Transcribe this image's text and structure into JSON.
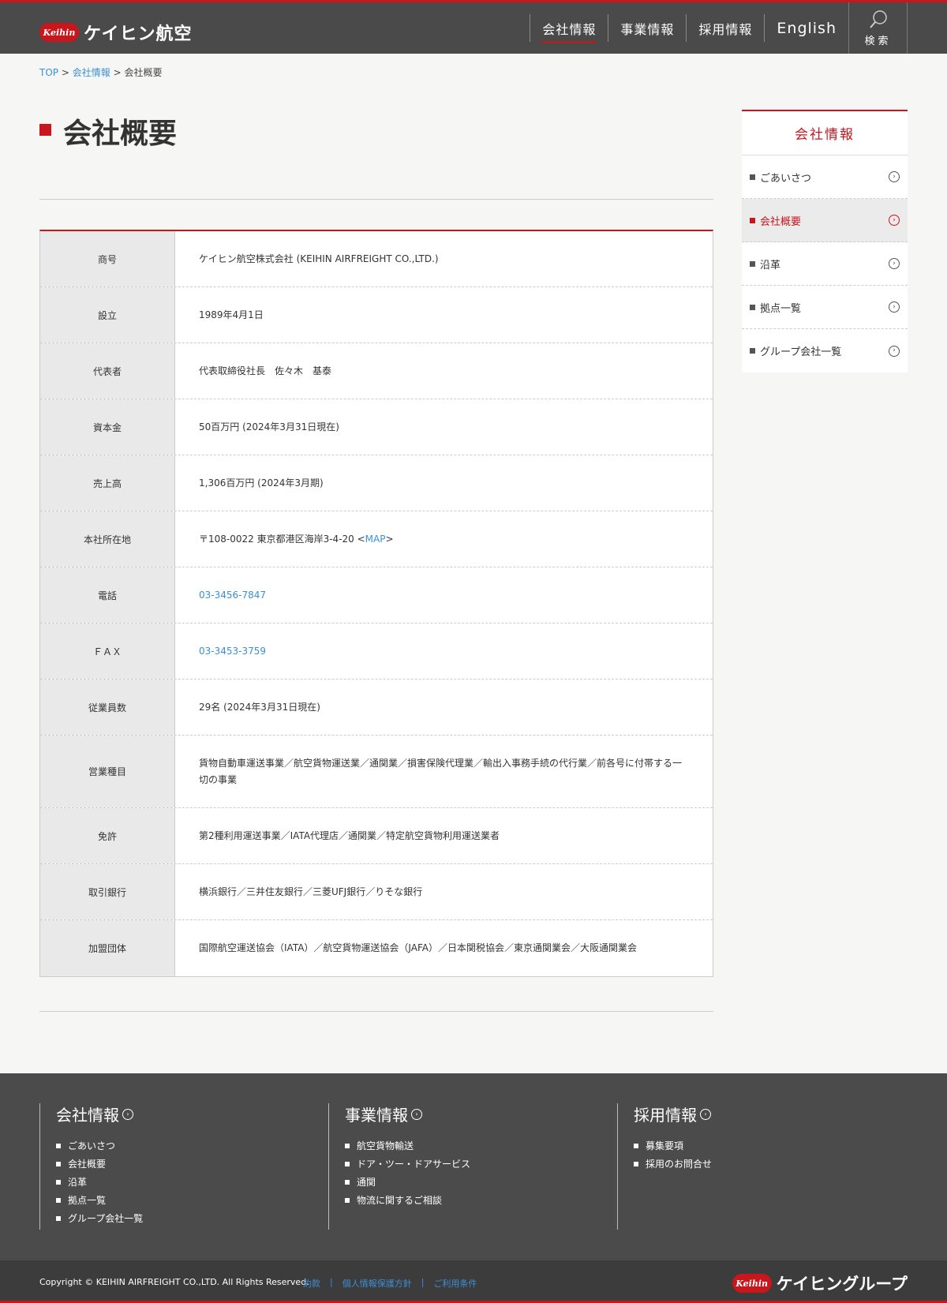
{
  "header": {
    "logo_badge": "Keihin",
    "logo_text": "ケイヒン航空",
    "nav": [
      "会社情報",
      "事業情報",
      "採用情報",
      "English"
    ],
    "search_label": "検索",
    "colors": {
      "brand": "#c8161d",
      "header_bg": "#4a4a4a"
    }
  },
  "breadcrumb": {
    "top": "TOP",
    "sep": ">",
    "parent": "会社情報",
    "current": "会社概要"
  },
  "page": {
    "title": "会社概要"
  },
  "table": [
    {
      "label": "商号",
      "value": "ケイヒン航空株式会社 (KEIHIN AIRFREIGHT CO.,LTD.)"
    },
    {
      "label": "設立",
      "value": "1989年4月1日"
    },
    {
      "label": "代表者",
      "value": "代表取締役社長　佐々木　基泰"
    },
    {
      "label": "資本金",
      "value": "50百万円 (2024年3月31日現在)"
    },
    {
      "label": "売上高",
      "value": "1,306百万円 (2024年3月期)"
    },
    {
      "label": "本社所在地",
      "value_prefix": "〒108-0022 東京都港区海岸3-4-20 <",
      "link": "MAP",
      "value_suffix": ">"
    },
    {
      "label": "電話",
      "link": "03-3456-7847"
    },
    {
      "label": "ＦＡＸ",
      "link": "03-3453-3759"
    },
    {
      "label": "従業員数",
      "value": "29名 (2024年3月31日現在)"
    },
    {
      "label": "営業種目",
      "value": "貨物自動車運送事業／航空貨物運送業／通関業／損害保険代理業／輸出入事務手続の代行業／前各号に付帯する一切の事業"
    },
    {
      "label": "免許",
      "value": "第2種利用運送事業／IATA代理店／通関業／特定航空貨物利用運送業者"
    },
    {
      "label": "取引銀行",
      "value": "横浜銀行／三井住友銀行／三菱UFJ銀行／りそな銀行"
    },
    {
      "label": "加盟団体",
      "value": "国際航空運送協会（IATA）／航空貨物運送協会（JAFA）／日本関税協会／東京通関業会／大阪通関業会"
    }
  ],
  "sidebar": {
    "title": "会社情報",
    "items": [
      "ごあいさつ",
      "会社概要",
      "沿革",
      "拠点一覧",
      "グループ会社一覧"
    ]
  },
  "footer": {
    "columns": [
      {
        "title": "会社情報",
        "items": [
          "ごあいさつ",
          "会社概要",
          "沿革",
          "拠点一覧",
          "グループ会社一覧"
        ]
      },
      {
        "title": "事業情報",
        "items": [
          "航空貨物輸送",
          "ドア・ツー・ドアサービス",
          "通関",
          "物流に関するご相談"
        ]
      },
      {
        "title": "採用情報",
        "items": [
          "募集要項",
          "採用のお問合せ"
        ]
      }
    ],
    "copyright": "Copyright © KEIHIN AIRFREIGHT CO.,LTD. All Rights Reserved.",
    "links": [
      "約款",
      "個人情報保護方針",
      "ご利用条件"
    ],
    "link_sep": "|",
    "group_badge": "Keihin",
    "group_text": "ケイヒングループ"
  }
}
